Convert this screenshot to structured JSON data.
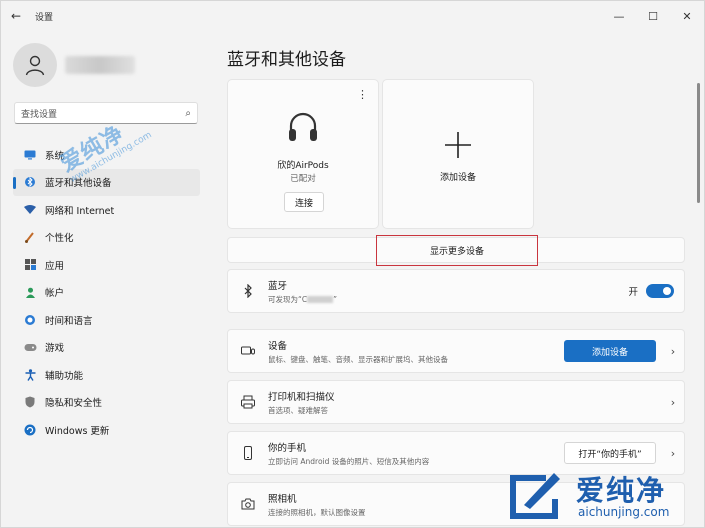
{
  "titlebar": {
    "back_icon": "back-arrow-icon",
    "title": "设置",
    "controls": [
      "—",
      "☐",
      "✕"
    ]
  },
  "sidebar": {
    "search_placeholder": "查找设置",
    "items": [
      {
        "label": "系统",
        "icon": "monitor-icon",
        "active": false
      },
      {
        "label": "蓝牙和其他设备",
        "icon": "bluetooth-icon",
        "active": true
      },
      {
        "label": "网络和 Internet",
        "icon": "wifi-icon",
        "active": false
      },
      {
        "label": "个性化",
        "icon": "brush-icon",
        "active": false
      },
      {
        "label": "应用",
        "icon": "apps-icon",
        "active": false
      },
      {
        "label": "帐户",
        "icon": "person-icon",
        "active": false
      },
      {
        "label": "时间和语言",
        "icon": "globe-clock-icon",
        "active": false
      },
      {
        "label": "游戏",
        "icon": "gamepad-icon",
        "active": false
      },
      {
        "label": "辅助功能",
        "icon": "accessibility-icon",
        "active": false
      },
      {
        "label": "隐私和安全性",
        "icon": "shield-icon",
        "active": false
      },
      {
        "label": "Windows 更新",
        "icon": "update-icon",
        "active": false
      }
    ]
  },
  "main": {
    "title": "蓝牙和其他设备",
    "device_card": {
      "name": "欣的AirPods",
      "status": "已配对",
      "connect_label": "连接"
    },
    "add_card": {
      "label": "添加设备"
    },
    "show_more_label": "显示更多设备",
    "bluetooth_row": {
      "title": "蓝牙",
      "subtitle_prefix": "可发现为“C",
      "subtitle_suffix": "”",
      "toggle_label": "开",
      "toggle_on": true
    },
    "devices_row": {
      "title": "设备",
      "subtitle": "鼠标、键盘、触笔、音频、显示器和扩展坞、其他设备",
      "button": "添加设备"
    },
    "printer_row": {
      "title": "打印机和扫描仪",
      "subtitle": "首选项、疑难解答"
    },
    "phone_row": {
      "title": "你的手机",
      "subtitle": "立即访问 Android 设备的照片、短信及其他内容",
      "button": "打开“你的手机”"
    },
    "camera_row": {
      "title": "照相机",
      "subtitle": "连接的照相机，默认图像设置"
    }
  },
  "watermark": {
    "text": "爱纯净",
    "url": "aichunjing.com",
    "url_full": "www.aichunjing.com"
  },
  "colors": {
    "accent": "#1a6fc4",
    "highlight_border": "#c9353e",
    "watermark": "#1f5fae"
  }
}
